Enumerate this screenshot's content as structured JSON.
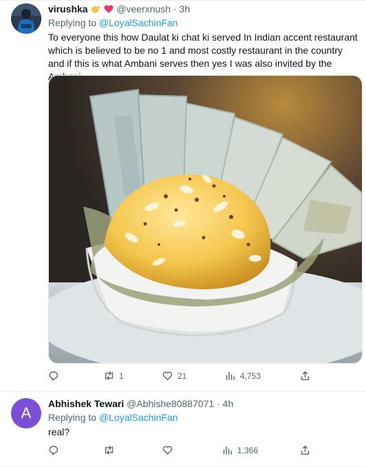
{
  "tweets": [
    {
      "name": "virushka",
      "handle": "@veerxnush",
      "separator": "·",
      "time": "3h",
      "replying_prefix": "Replying to",
      "replying_to": "@LoyalSachinFan",
      "text": "To everyone this how Daulat ki chat ki served In Indian accent restaurant which is believed to be no 1 and most costly restaurant in the country and if this is what Ambani serves then yes I was also invited by the Ambani",
      "media_icon": "dessert-photo",
      "actions": {
        "reply_count": "",
        "retweet_count": "1",
        "like_count": "21",
        "views_count": "4,753"
      }
    },
    {
      "name": "Abhishek Tewari",
      "handle": "@Abhishe80887071",
      "separator": "·",
      "time": "4h",
      "avatar_letter": "A",
      "avatar_color": "#7b4fd6",
      "replying_prefix": "Replying to",
      "replying_to": "@LoyalSachinFan",
      "text": "real?",
      "actions": {
        "reply_count": "",
        "retweet_count": "",
        "like_count": "",
        "views_count": "1,366"
      }
    }
  ],
  "colors": {
    "link": "#1d9bf0",
    "muted": "#536471",
    "text": "#0f1419",
    "border": "#e6ecf0"
  },
  "icons": {
    "reply": "reply-icon",
    "retweet": "retweet-icon",
    "like": "heart-icon",
    "views": "views-bar-chart-icon",
    "share": "share-upload-icon"
  }
}
